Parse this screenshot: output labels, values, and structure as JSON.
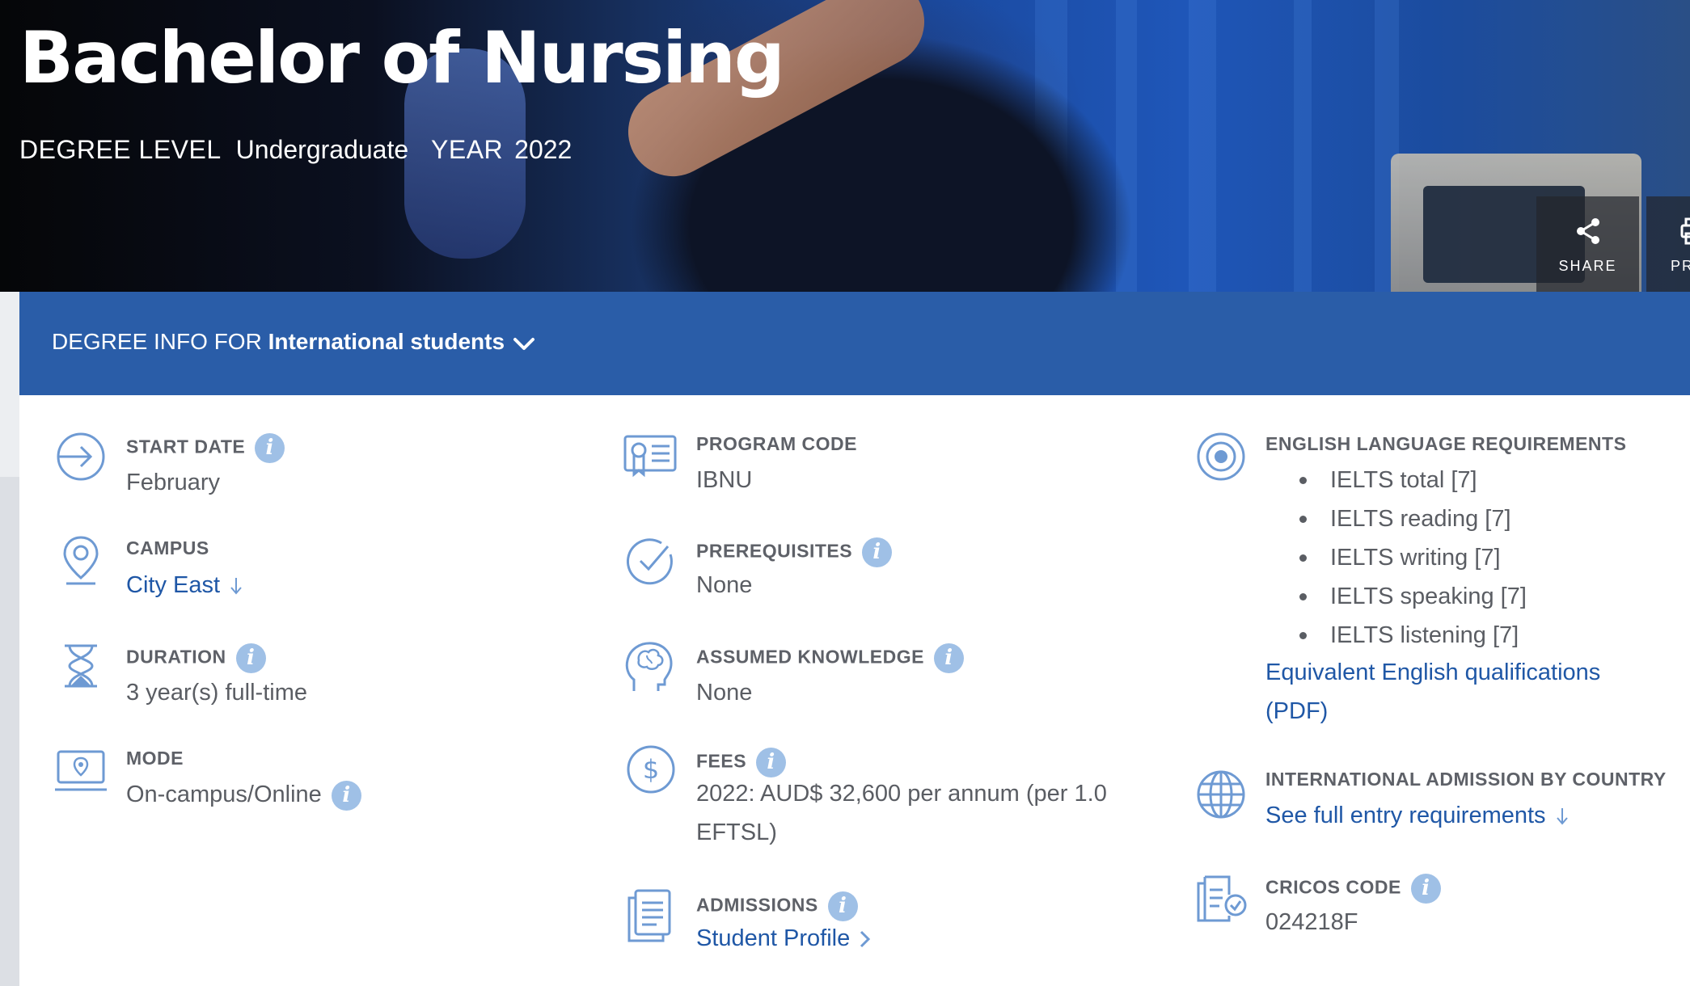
{
  "hero": {
    "title": "Bachelor of Nursing",
    "degree_level_label": "DEGREE LEVEL",
    "degree_level_value": "Undergraduate",
    "year_label": "YEAR",
    "year_value": "2022",
    "share_label": "SHARE",
    "print_label": "PR",
    "share_icon": "share-icon",
    "print_icon": "print-icon"
  },
  "degree_bar": {
    "prefix": "DEGREE INFO FOR",
    "audience": "International students",
    "icon": "chevron-down-icon"
  },
  "col1": {
    "start_date": {
      "label": "START DATE",
      "value": "February",
      "icon": "arrow-right-circle-icon"
    },
    "campus": {
      "label": "CAMPUS",
      "value": "City East",
      "icon": "location-pin-icon"
    },
    "duration": {
      "label": "DURATION",
      "value": "3 year(s) full-time",
      "icon": "hourglass-icon"
    },
    "mode": {
      "label": "MODE",
      "value": "On-campus/Online",
      "icon": "laptop-location-icon"
    }
  },
  "col2": {
    "program_code": {
      "label": "PROGRAM CODE",
      "value": "IBNU",
      "icon": "certificate-icon"
    },
    "prerequisites": {
      "label": "PREREQUISITES",
      "value": "None",
      "icon": "check-circle-icon"
    },
    "assumed_knowledge": {
      "label": "ASSUMED KNOWLEDGE",
      "value": "None",
      "icon": "brain-head-icon"
    },
    "fees": {
      "label": "FEES",
      "value_line1": "2022: AUD$ 32,600 per annum (per 1.0",
      "value_line2": "EFTSL)",
      "icon": "dollar-circle-icon"
    },
    "admissions": {
      "label": "ADMISSIONS",
      "value": "Student Profile",
      "icon": "document-icon"
    }
  },
  "col3": {
    "english": {
      "label": "ENGLISH LANGUAGE REQUIREMENTS",
      "icon": "target-icon",
      "items": [
        "IELTS total [7]",
        "IELTS reading [7]",
        "IELTS writing [7]",
        "IELTS speaking [7]",
        "IELTS listening [7]"
      ],
      "link_line1": "Equivalent English qualifications",
      "link_line2": "(PDF)"
    },
    "intl_admission": {
      "label": "INTERNATIONAL ADMISSION BY COUNTRY",
      "value": "See full entry requirements",
      "icon": "globe-icon"
    },
    "cricos": {
      "label": "CRICOS CODE",
      "value": "024218F",
      "icon": "checklist-icon"
    }
  },
  "info_glyph": "i",
  "colors": {
    "accent": "#2a5da8",
    "link": "#1f57a6",
    "icon": "#6e9ad3",
    "info_badge": "#9fc0e6"
  }
}
